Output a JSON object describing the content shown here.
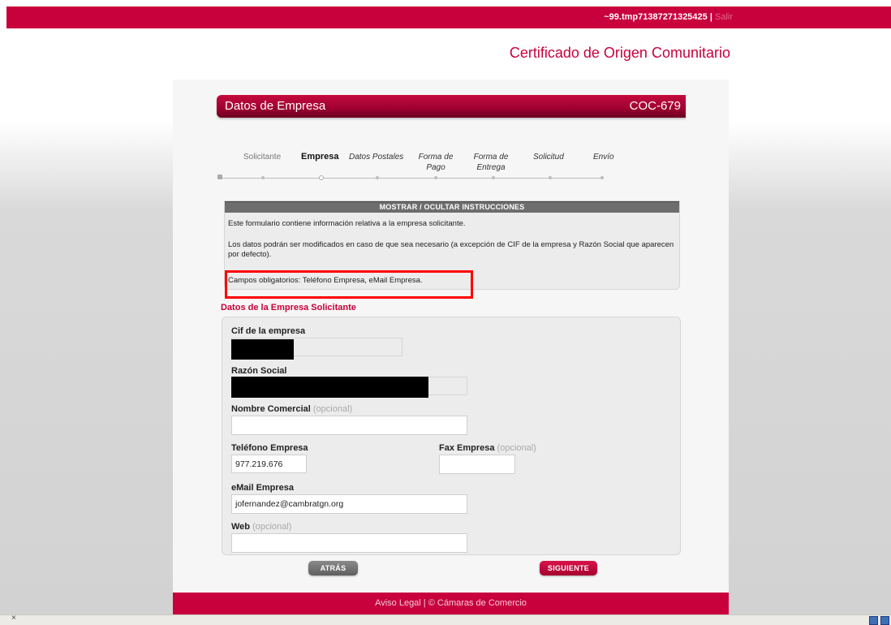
{
  "topbar": {
    "user": "~99.tmp71387271325425 |",
    "logout": "Salir"
  },
  "app_title": "Certificado de Origen Comunitario",
  "section": {
    "title": "Datos de Empresa",
    "code": "COC-679"
  },
  "steps": [
    {
      "label": "Solicitante",
      "state": "done"
    },
    {
      "label": "Empresa",
      "state": "current"
    },
    {
      "label": "Datos Postales",
      "state": "todo"
    },
    {
      "label": "Forma de Pago",
      "state": "todo"
    },
    {
      "label": "Forma de Entrega",
      "state": "todo"
    },
    {
      "label": "Solicitud",
      "state": "todo"
    },
    {
      "label": "Envío",
      "state": "todo"
    }
  ],
  "instructions": {
    "toggle": "MOSTRAR / OCULTAR INSTRUCCIONES",
    "p1": "Este formulario contiene información relativa a la empresa solicitante.",
    "p2": "Los datos podrán ser modificados en caso de que sea necesario (a excepción de CIF de la empresa y Razón Social que aparecen por defecto).",
    "p3": "Campos obligatorios: Teléfono Empresa, eMail Empresa."
  },
  "form": {
    "heading": "Datos de la Empresa Solicitante",
    "optional": "(opcional)",
    "cif_label": "Cif de la empresa",
    "razon_label": "Razón Social",
    "nombre_label": "Nombre Comercial",
    "telefono_label": "Teléfono Empresa",
    "telefono_value": "977.219.676",
    "fax_label": "Fax Empresa",
    "email_label": "eMail Empresa",
    "email_value": "jofernandez@cambratgn.org",
    "web_label": "Web"
  },
  "buttons": {
    "back": "ATRÁS",
    "next": "SIGUIENTE"
  },
  "footer": "Aviso Legal | © Cámaras de Comercio",
  "statusbar": {
    "close": "×"
  },
  "colors": {
    "brand": "#c8003c",
    "highlight": "#ff0000"
  }
}
